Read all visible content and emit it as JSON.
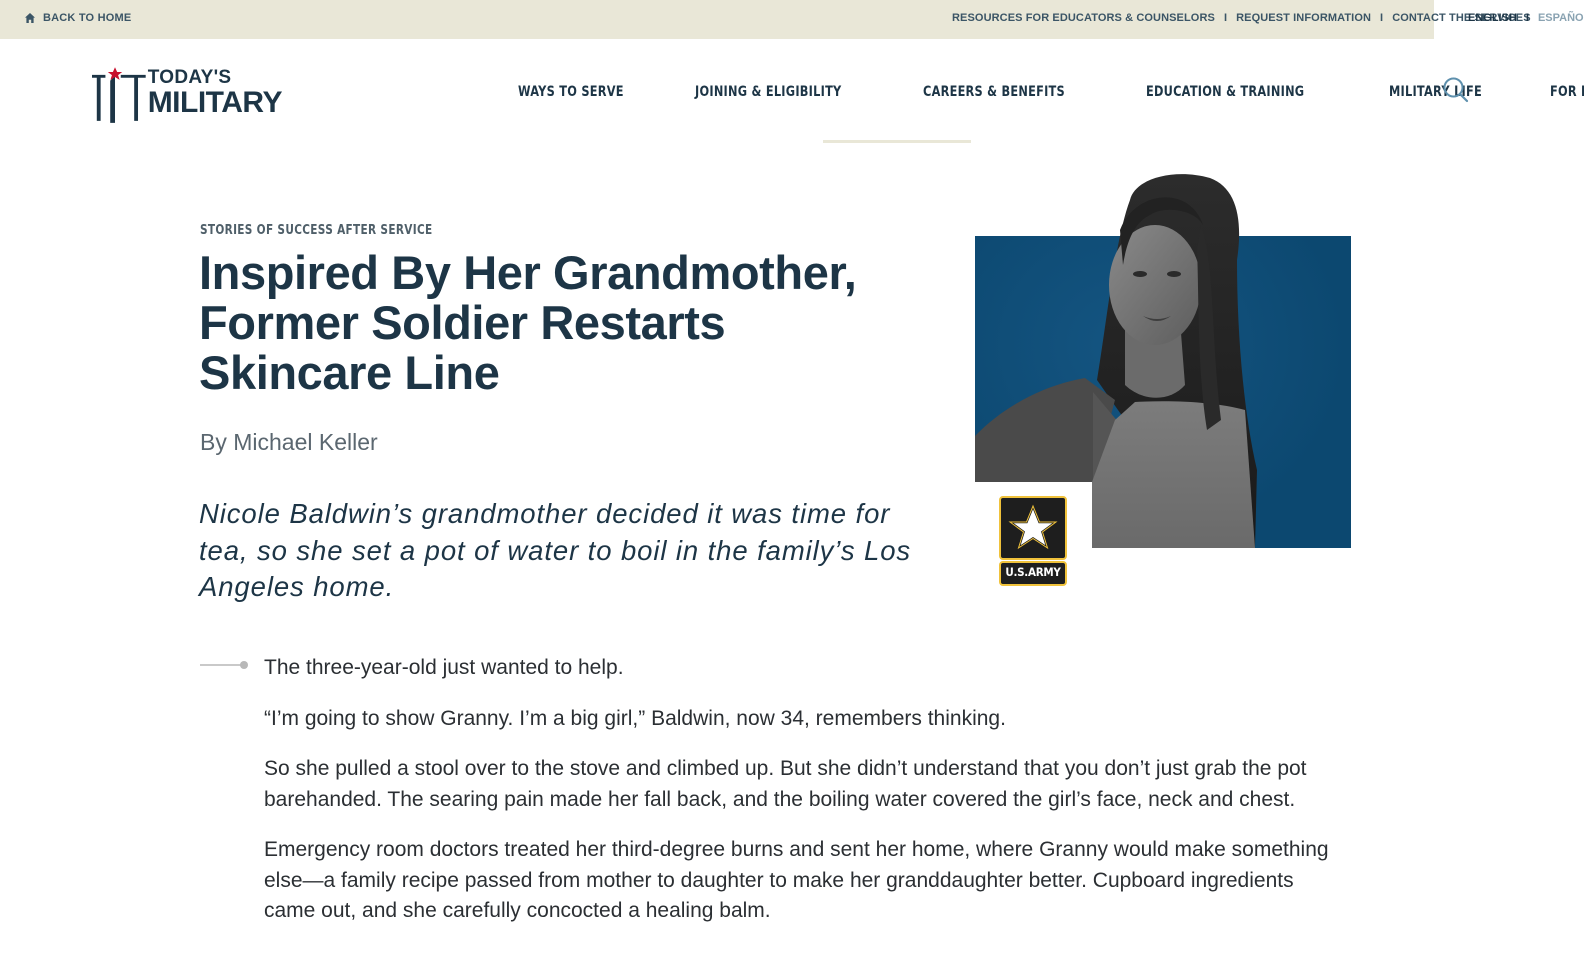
{
  "utility_bar": {
    "back_home": "BACK TO HOME",
    "links": [
      "RESOURCES FOR EDUCATORS & COUNSELORS",
      "REQUEST INFORMATION",
      "CONTACT THE SERVICES"
    ],
    "separator": "I",
    "languages": {
      "active": "ENGLISH",
      "inactive": "ESPAÑOL"
    }
  },
  "logo": {
    "line1": "TODAY'S",
    "line2": "MILITARY"
  },
  "nav": {
    "items": [
      "WAYS TO SERVE",
      "JOINING & ELIGIBILITY",
      "CAREERS & BENEFITS",
      "EDUCATION & TRAINING",
      "MILITARY LIFE",
      "FOR PARENTS"
    ],
    "active_index": 2
  },
  "article": {
    "eyebrow": "STORIES OF SUCCESS AFTER SERVICE",
    "headline": "Inspired By Her Grandmother, Former Soldier Restarts Skincare Line",
    "byline": "By Michael Keller",
    "lede": "Nicole Baldwin’s grandmother decided it was time for tea, so she set a pot of water to boil in the family’s Los Angeles home.",
    "paragraphs": [
      "The three-year-old just wanted to help.",
      "“I’m going to show Granny. I’m a big girl,” Baldwin, now 34, remembers thinking.",
      "So she pulled a stool over to the stove and climbed up. But she didn’t understand that you don’t just grab the pot barehanded. The searing pain made her fall back, and the boiling water covered the girl’s face, neck and chest.",
      "Emergency room doctors treated her third-degree burns and sent her home, where Granny would make something else—a family recipe passed from mother to daughter to make her granddaughter better. Cupboard ingredients came out, and she carefully concocted a healing balm."
    ]
  },
  "badge": {
    "label": "U.S.ARMY"
  },
  "colors": {
    "navy": "#1d3546",
    "utility_bg": "#e9e7d7",
    "hero_blue": "#0c4870",
    "logo_red": "#c8102e",
    "army_gold": "#f0c23b"
  },
  "icons": {
    "home": "home-icon",
    "search": "search-icon",
    "star": "army-star-icon"
  }
}
